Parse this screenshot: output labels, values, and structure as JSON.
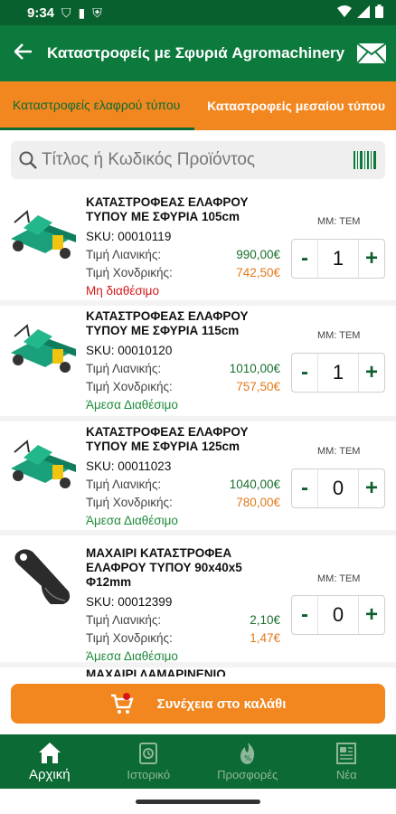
{
  "status_bar": {
    "time": "9:34"
  },
  "app_bar": {
    "title": "Καταστροφείς με Σφυριά Agromachinery"
  },
  "tabs": [
    {
      "label": "Καταστροφείς ελαφρού τύπου"
    },
    {
      "label": "Καταστροφείς μεσαίου τύπου"
    }
  ],
  "search": {
    "placeholder": "Τίτλος ή Κωδικός Προϊόντος"
  },
  "labels": {
    "retail": "Τιμή Λιανικής:",
    "wholesale": "Τιμή Χονδρικής:",
    "unit": "ΜΜ: ΤΕΜ",
    "sku_prefix": "SKU: "
  },
  "products": [
    {
      "name": "ΚΑΤΑΣΤΡΟΦΕΑΣ ΕΛΑΦΡΟΥ ΤΥΠΟΥ ΜΕ ΣΦΥΡΙΑ 105cm",
      "sku": "SKU: 00010119",
      "retail": "990,00€",
      "wholesale": "742,50€",
      "availability": "Μη διαθέσιμο",
      "qty": "1"
    },
    {
      "name": "ΚΑΤΑΣΤΡΟΦΕΑΣ ΕΛΑΦΡΟΥ ΤΥΠΟΥ ΜΕ ΣΦΥΡΙΑ 115cm",
      "sku": "SKU: 00010120",
      "retail": "1010,00€",
      "wholesale": "757,50€",
      "availability": "Άμεσα Διαθέσιμο",
      "qty": "1"
    },
    {
      "name": "ΚΑΤΑΣΤΡΟΦΕΑΣ ΕΛΑΦΡΟΥ ΤΥΠΟΥ ΜΕ ΣΦΥΡΙΑ 125cm",
      "sku": "SKU: 00011023",
      "retail": "1040,00€",
      "wholesale": "780,00€",
      "availability": "Άμεσα Διαθέσιμο",
      "qty": "0"
    },
    {
      "name": "ΜΑΧΑΙΡΙ ΚΑΤΑΣΤΡΟΦΕΑ ΕΛΑΦΡΟΥ ΤΥΠΟΥ 90x40x5 Φ12mm",
      "sku": "SKU: 00012399",
      "retail": "2,10€",
      "wholesale": "1,47€",
      "availability": "Άμεσα Διαθέσιμο",
      "qty": "0"
    },
    {
      "name": "ΜΑΧΑΙΡΙ ΛΑΜΑΡΙΝΕΝΙΟ"
    }
  ],
  "steppers": {
    "minus": "-",
    "plus": "+"
  },
  "cta": {
    "label": "Συνέχεια στο καλάθι"
  },
  "bottom_nav": [
    {
      "label": "Αρχική"
    },
    {
      "label": "Ιστορικό"
    },
    {
      "label": "Προσφορές"
    },
    {
      "label": "Νέα"
    }
  ],
  "colors": {
    "green": "#0c7a3d",
    "dark_green": "#0c6b34",
    "orange": "#f2871f",
    "red": "#d4171a"
  }
}
